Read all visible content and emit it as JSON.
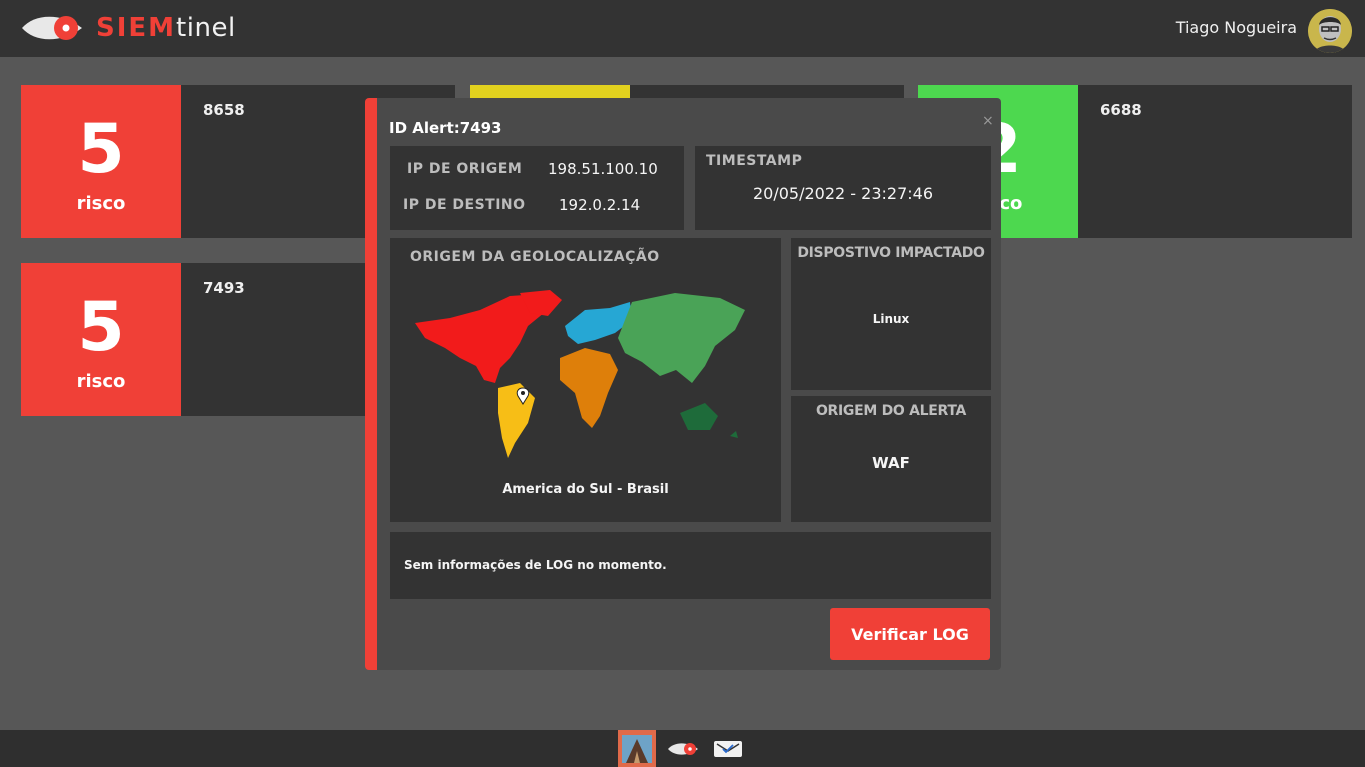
{
  "header": {
    "brand_part1": "SIEM",
    "brand_part2": "tinel",
    "user_name": "Tiago Nogueira"
  },
  "colors": {
    "accent": "#f04037",
    "risk_high": "#f04037",
    "risk_medium": "#e1d11e",
    "risk_low": "#4dd84f"
  },
  "cards": [
    {
      "risk": "5",
      "risk_label": "risco",
      "alert_id": "8658"
    },
    {
      "risk": "",
      "risk_label": "",
      "alert_id": ""
    },
    {
      "risk": "2",
      "risk_label": "risco",
      "alert_id": "6688"
    },
    {
      "risk": "5",
      "risk_label": "risco",
      "alert_id": "7493"
    }
  ],
  "modal": {
    "title": "ID Alert:7493",
    "close": "×",
    "ip_origem_label": "IP DE ORIGEM",
    "ip_origem": "198.51.100.10",
    "ip_destino_label": "IP DE DESTINO",
    "ip_destino": "192.0.2.14",
    "timestamp_label": "TIMESTAMP",
    "timestamp": "20/05/2022 - 23:27:46",
    "geo_label": "ORIGEM DA GEOLOCALIZAÇÃO",
    "geo_value": "America do Sul - Brasil",
    "device_label": "DISPOSTIVO IMPACTADO",
    "device_value": "Linux",
    "alert_origin_label": "ORIGEM DO ALERTA",
    "alert_origin_value": "WAF",
    "log_text": "Sem informações de LOG no momento.",
    "verify_button": "Verificar LOG"
  },
  "taskbar": {
    "icons": [
      "mountain-app-icon",
      "siemtinel-app-icon",
      "mail-app-icon"
    ]
  }
}
